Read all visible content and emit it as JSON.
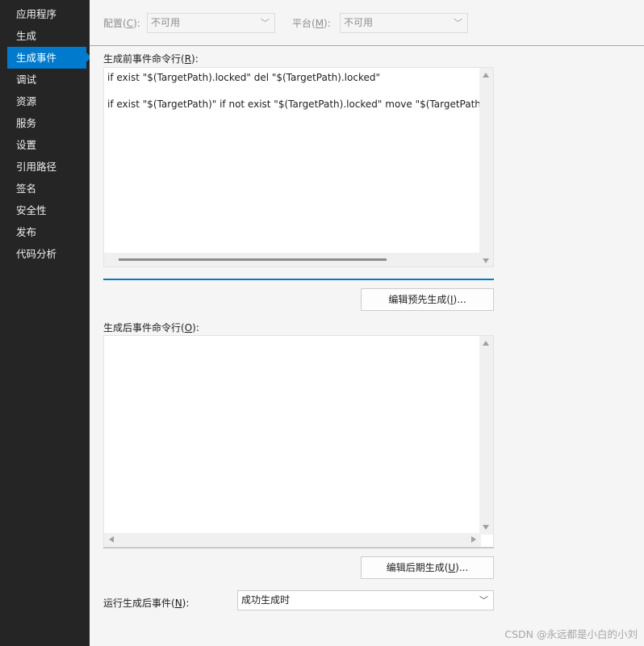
{
  "sidebar": {
    "items": [
      {
        "label": "应用程序"
      },
      {
        "label": "生成"
      },
      {
        "label": "生成事件",
        "active": true
      },
      {
        "label": "调试"
      },
      {
        "label": "资源"
      },
      {
        "label": "服务"
      },
      {
        "label": "设置"
      },
      {
        "label": "引用路径"
      },
      {
        "label": "签名"
      },
      {
        "label": "安全性"
      },
      {
        "label": "发布"
      },
      {
        "label": "代码分析"
      }
    ]
  },
  "toolbar": {
    "config_label_prefix": "配置(",
    "config_label_key": "C",
    "config_label_suffix": "):",
    "config_value": "不可用",
    "platform_label_prefix": "平台(",
    "platform_label_key": "M",
    "platform_label_suffix": "):",
    "platform_value": "不可用"
  },
  "prebuild": {
    "label_prefix": "生成前事件命令行(",
    "label_key": "R",
    "label_suffix": "):",
    "lines": [
      "if exist \"$(TargetPath).locked\" del \"$(TargetPath).locked\"",
      "if exist \"$(TargetPath)\" if not exist \"$(TargetPath).locked\" move \"$(TargetPath)\""
    ],
    "edit_button_prefix": "编辑预先生成(",
    "edit_button_key": "I",
    "edit_button_suffix": ")..."
  },
  "postbuild": {
    "label_prefix": "生成后事件命令行(",
    "label_key": "O",
    "label_suffix": "):",
    "lines": [],
    "edit_button_prefix": "编辑后期生成(",
    "edit_button_key": "U",
    "edit_button_suffix": ")..."
  },
  "run_post": {
    "label_prefix": "运行生成后事件(",
    "label_key": "N",
    "label_suffix": "):",
    "value": "成功生成时"
  },
  "watermark": "CSDN @永远都是小白的小刘",
  "colors": {
    "sidebar_bg": "#252526",
    "accent": "#007acc",
    "panel_bg": "#f5f5f5"
  }
}
